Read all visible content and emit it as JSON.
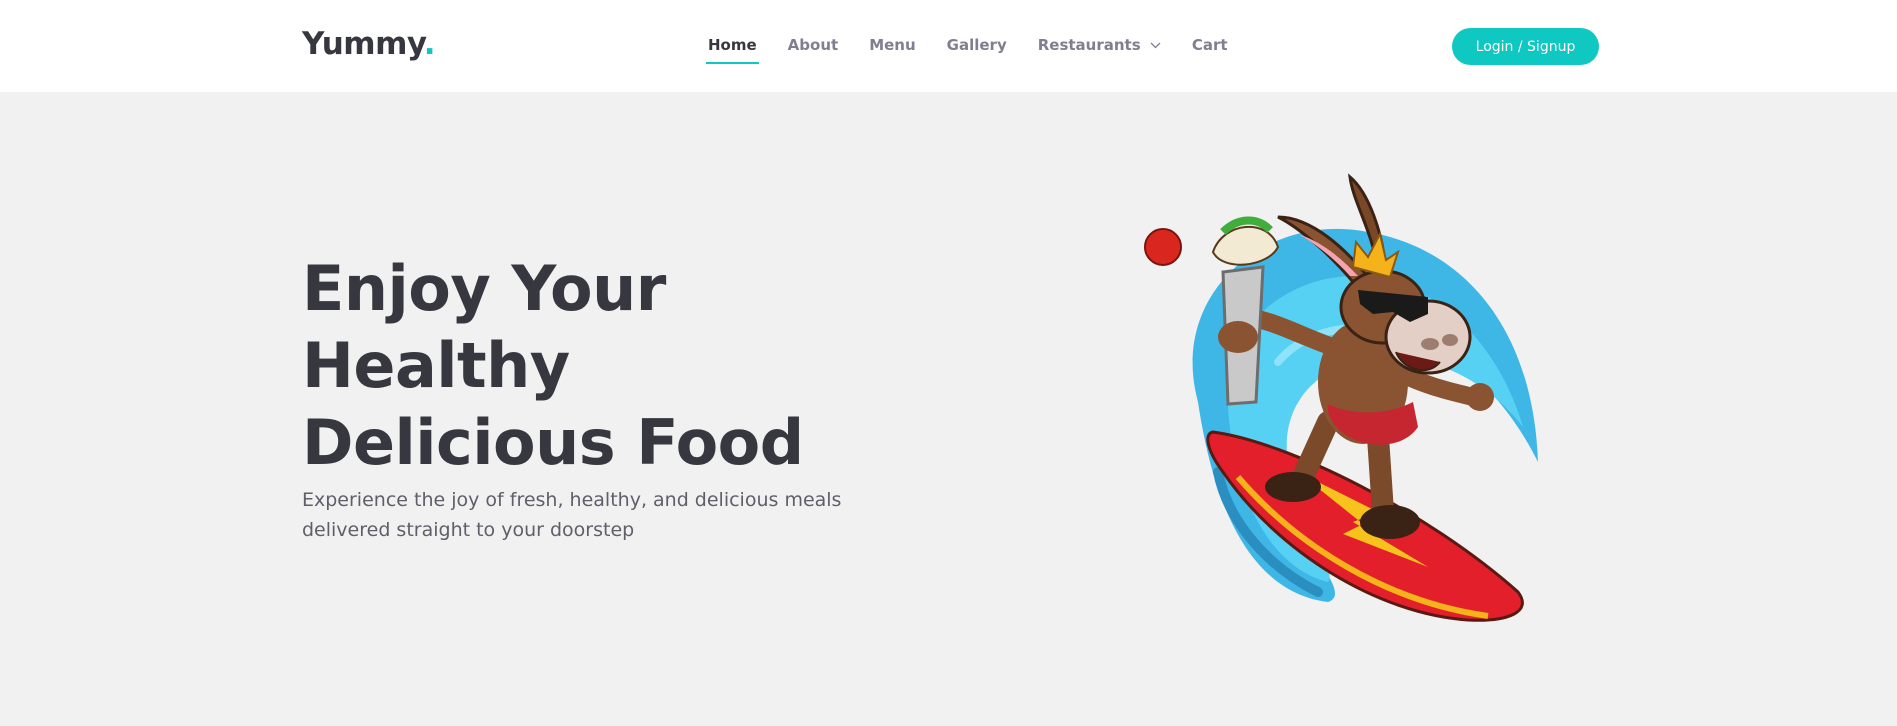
{
  "brand": {
    "name": "Yummy",
    "dot": "."
  },
  "nav": {
    "items": [
      {
        "label": "Home",
        "active": true
      },
      {
        "label": "About"
      },
      {
        "label": "Menu"
      },
      {
        "label": "Gallery"
      },
      {
        "label": "Restaurants",
        "dropdown": true
      },
      {
        "label": "Cart"
      }
    ]
  },
  "header": {
    "login_label": "Login / Signup"
  },
  "hero": {
    "title_lines": [
      "Enjoy Your",
      "Healthy",
      "Delicious Food"
    ],
    "subtitle": "Experience the joy of fresh, healthy, and delicious meals delivered straight to your doorstep"
  },
  "mascot": {
    "icon": "surfing-donkey-mascot-illustration"
  },
  "colors": {
    "accent": "#0fc8c2",
    "background": "#f1f1f1",
    "text": "#37373f"
  }
}
